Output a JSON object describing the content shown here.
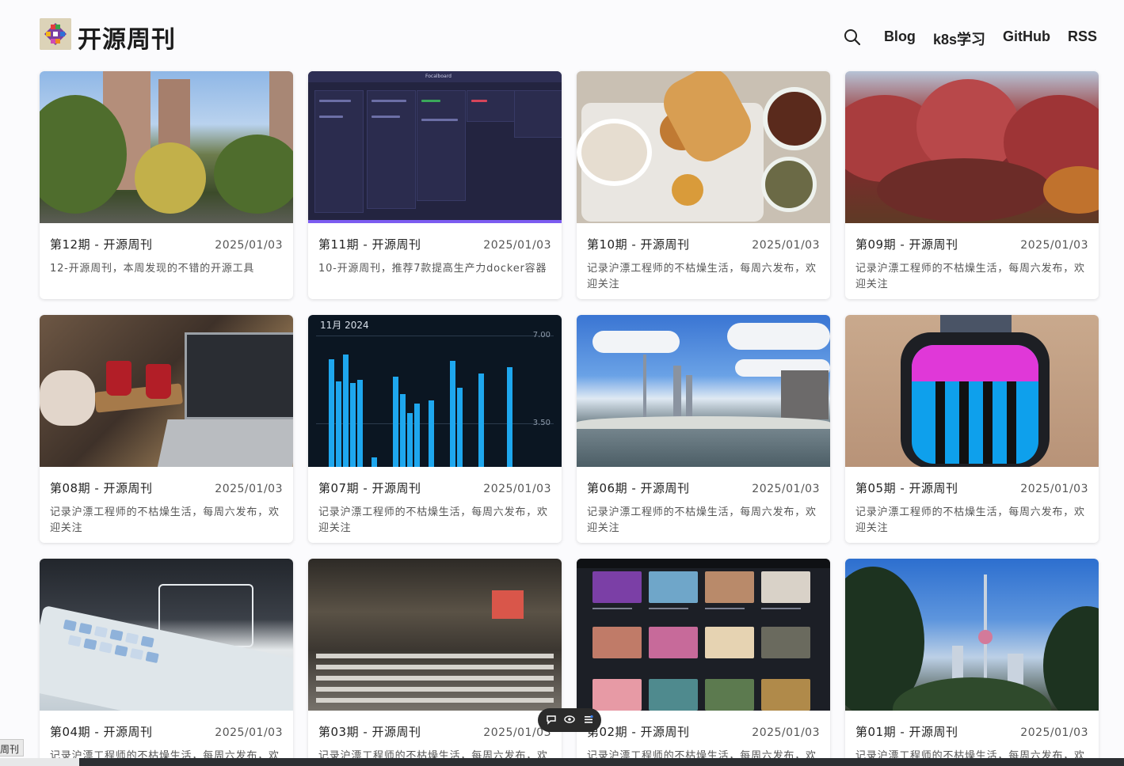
{
  "site": {
    "title": "开源周刊"
  },
  "nav": {
    "items": [
      "Blog",
      "k8s学习",
      "GitHub",
      "RSS"
    ]
  },
  "thumb_texts": {
    "chart_month": "11月 2024",
    "chart_axis_top": "7.00",
    "chart_axis_mid": "3.50",
    "board_title": "Focalboard"
  },
  "cards": [
    {
      "title": "第12期 - 开源周刊",
      "date": "2025/01/03",
      "desc": "12-开源周刊，本周发现的不错的开源工具"
    },
    {
      "title": "第11期 - 开源周刊",
      "date": "2025/01/03",
      "desc": "10-开源周刊，推荐7款提高生产力docker容器"
    },
    {
      "title": "第10期 - 开源周刊",
      "date": "2025/01/03",
      "desc": "记录沪漂工程师的不枯燥生活，每周六发布，欢迎关注"
    },
    {
      "title": "第09期 - 开源周刊",
      "date": "2025/01/03",
      "desc": "记录沪漂工程师的不枯燥生活，每周六发布，欢迎关注"
    },
    {
      "title": "第08期 - 开源周刊",
      "date": "2025/01/03",
      "desc": "记录沪漂工程师的不枯燥生活，每周六发布，欢迎关注"
    },
    {
      "title": "第07期 - 开源周刊",
      "date": "2025/01/03",
      "desc": "记录沪漂工程师的不枯燥生活，每周六发布，欢迎关注"
    },
    {
      "title": "第06期 - 开源周刊",
      "date": "2025/01/03",
      "desc": "记录沪漂工程师的不枯燥生活，每周六发布，欢迎关注"
    },
    {
      "title": "第05期 - 开源周刊",
      "date": "2025/01/03",
      "desc": "记录沪漂工程师的不枯燥生活，每周六发布，欢迎关注"
    },
    {
      "title": "第04期 - 开源周刊",
      "date": "2025/01/03",
      "desc": "记录沪漂工程师的不枯燥生活，每周六发布，欢迎关注"
    },
    {
      "title": "第03期 - 开源周刊",
      "date": "2025/01/03",
      "desc": "记录沪漂工程师的不枯燥生活，每周六发布，欢迎关注"
    },
    {
      "title": "第02期 - 开源周刊",
      "date": "2025/01/03",
      "desc": "记录沪漂工程师的不枯燥生活，每周六发布，欢迎关注"
    },
    {
      "title": "第01期 - 开源周刊",
      "date": "2025/01/03",
      "desc": "记录沪漂工程师的不枯燥生活，每周六发布，欢迎关注"
    }
  ],
  "side_tab": {
    "label": "周刊"
  },
  "colors": {
    "accent_bar": "#1ea7ee",
    "card_bg": "#ffffff",
    "page_bg": "#fbfbfd",
    "fab_bg": "#2b2b2b"
  },
  "icons": {
    "search": "search-icon",
    "comment": "comment-icon",
    "eye": "eye-icon",
    "list": "list-icon"
  }
}
